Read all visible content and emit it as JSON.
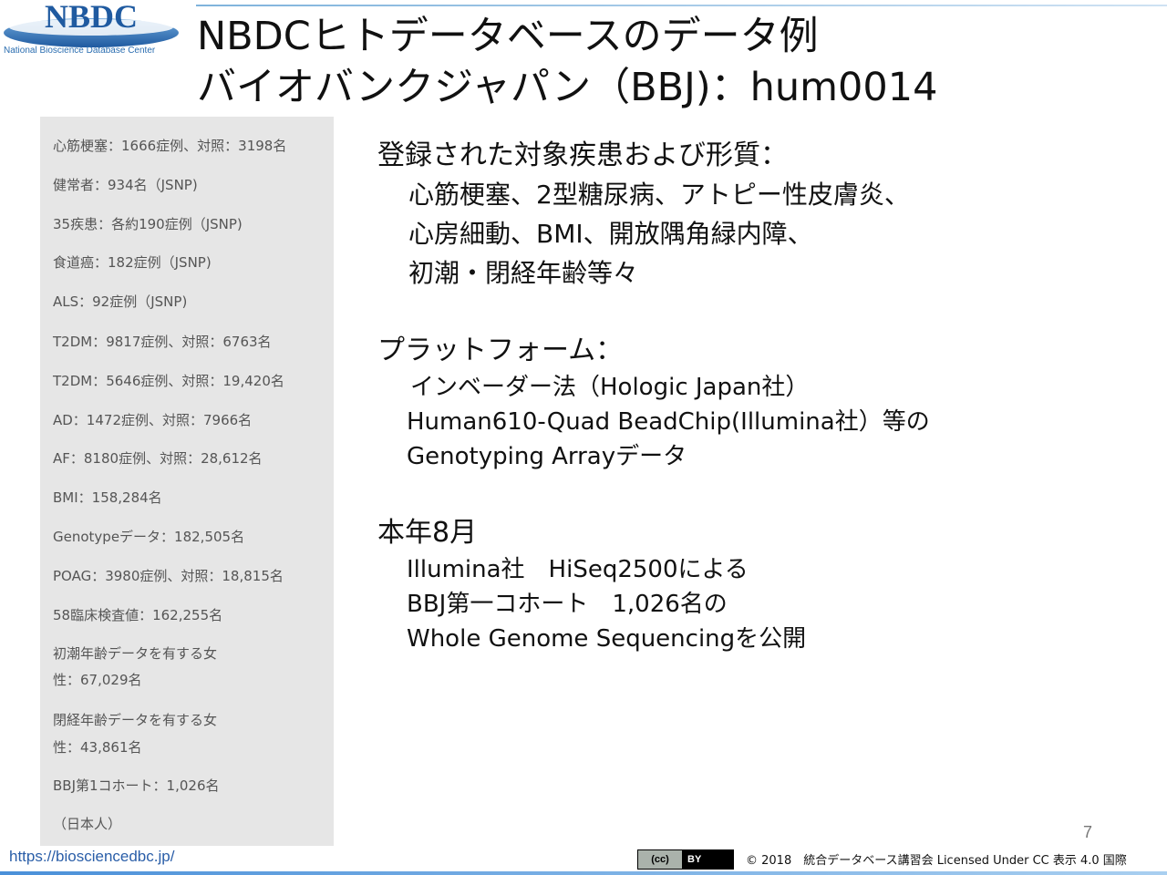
{
  "logo": {
    "acronym": "NBDC",
    "subtitle": "National Bioscience Database Center"
  },
  "title": {
    "line1": "NBDCヒトデータベースのデータ例",
    "line2": "バイオバンクジャパン（BBJ)：hum0014"
  },
  "sidebar": {
    "items": [
      "心筋梗塞：1666症例、対照：3198名",
      "健常者：934名（JSNP)",
      "35疾患：各約190症例（JSNP)",
      "食道癌：182症例（JSNP)",
      "ALS：92症例（JSNP)",
      "T2DM：9817症例、対照：6763名",
      "T2DM：5646症例、対照：19,420名",
      "AD：1472症例、対照：7966名",
      "AF：8180症例、対照：28,612名",
      "BMI：158,284名",
      "Genotypeデータ：182,505名",
      "POAG：3980症例、対照：18,815名",
      "58臨床検査値：162,255名",
      "初潮年齢データを有する女",
      "性：67,029名",
      "閉経年齢データを有する女",
      "性：43,861名",
      "BBJ第1コホート：1,026名",
      "（日本人）"
    ]
  },
  "main": {
    "diseases": {
      "heading": "登録された対象疾患および形質：",
      "lines": [
        "心筋梗塞、2型糖尿病、アトピー性皮膚炎、",
        "心房細動、BMI、開放隅角緑内障、",
        "初潮・閉経年齢等々"
      ]
    },
    "platform": {
      "heading": "プラットフォーム：",
      "lines": [
        "インベーダー法（Hologic Japan社）",
        "Human610-Quad BeadChip(Illumina社）等の",
        "Genotyping Arrayデータ"
      ]
    },
    "august": {
      "heading": "本年8月",
      "lines": [
        "Illumina社　HiSeq2500による",
        "BBJ第一コホート　1,026名の",
        "Whole Genome Sequencingを公開"
      ]
    }
  },
  "footer": {
    "page_number": "7",
    "url": "https://biosciencedbc.jp/",
    "cc_left": "(cc)",
    "cc_right": "BY",
    "license": "© 2018　統合データベース講習会 Licensed Under CC 表示 4.0 国際"
  },
  "colors": {
    "sidebar_bg": "#e6e6e6",
    "logo_blue": "#2a6db0",
    "url_blue": "#2a5ea8"
  }
}
